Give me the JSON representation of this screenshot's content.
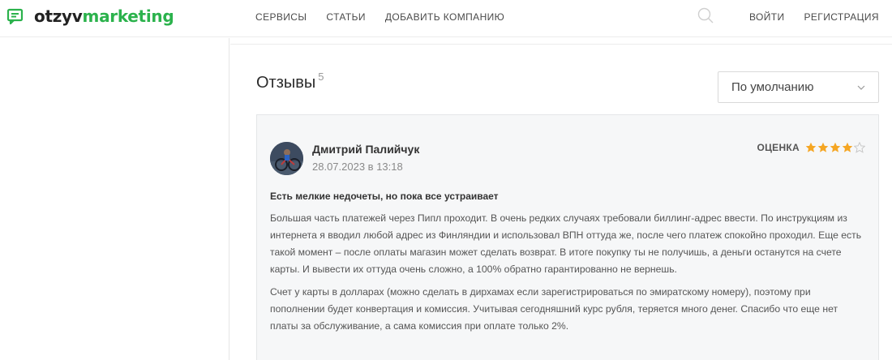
{
  "header": {
    "logo": {
      "part1": "otzyv",
      "part2": "marketing"
    },
    "nav": [
      "СЕРВИСЫ",
      "СТАТЬИ",
      "ДОБАВИТЬ КОМПАНИЮ"
    ],
    "auth": {
      "login": "ВОЙТИ",
      "register": "РЕГИСТРАЦИЯ"
    }
  },
  "reviews": {
    "title": "Отзывы",
    "count": "5",
    "sort_selected": "По умолчанию"
  },
  "review": {
    "author": "Дмитрий Палийчук",
    "date": "28.07.2023 в 13:18",
    "rating_label": "ОЦЕНКА",
    "rating": 4,
    "rating_max": 5,
    "title": "Есть мелкие недочеты, но пока все устраивает",
    "paragraphs": [
      "Большая часть платежей через Пипл проходит. В очень редких случаях требовали биллинг-адрес ввести. По инструкциям из интернета я вводил любой адрес из Финляндии и использовал ВПН оттуда же, после чего платеж спокойно проходил. Еще есть такой момент – после оплаты магазин может сделать возврат. В итоге покупку ты не получишь, а деньги останутся на счете карты. И вывести их оттуда очень сложно, а 100% обратно гарантированно не вернешь.",
      "Счет у карты в долларах (можно сделать в дирхамах если зарегистрироваться по эмиратскому номеру), поэтому при пополнении будет конвертация и комиссия. Учитывая сегодняшний курс рубля, теряется много денег. Спасибо что еще нет платы за обслуживание, а сама комиссия при оплате только 2%."
    ]
  },
  "colors": {
    "brand": "#2bb24c",
    "star": "#f5a623",
    "card_bg": "#f6f7f8"
  }
}
